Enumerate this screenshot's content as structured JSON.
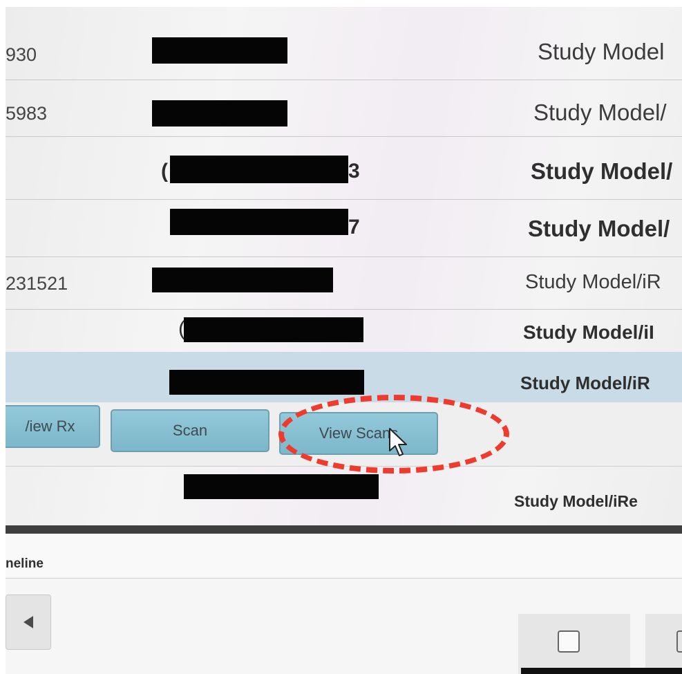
{
  "rows": [
    {
      "case_id": "930",
      "type": "Study Model",
      "bold": false
    },
    {
      "case_id": "5983",
      "type": "Study Model/",
      "bold": false
    },
    {
      "case_id": "",
      "peek_left": "(",
      "peek_right": "3",
      "type": "Study Model/",
      "bold": true
    },
    {
      "case_id": "",
      "peek_right": "7",
      "type": "Study Model/",
      "bold": true
    },
    {
      "case_id": "231521",
      "type": "Study Model/iR",
      "bold": false
    },
    {
      "case_id": "",
      "peek_left": "(",
      "type": "Study Model/iI",
      "bold": true
    },
    {
      "case_id": "",
      "type": "Study Model/iR",
      "bold": true,
      "selected": true
    },
    {
      "case_id": "",
      "type": "Study Model/iRe",
      "bold": true
    }
  ],
  "actions": {
    "view_rx": "/iew Rx",
    "scan": "Scan",
    "view_scans": "View Scans"
  },
  "timeline": {
    "label": "neline"
  },
  "colors": {
    "button_fill": "#88c0d3",
    "selected_row": "#c9dbe7",
    "annotation": "#ef3a2e"
  },
  "icons": {
    "prev": "triangle-left-icon",
    "cursor": "mouse-pointer-icon"
  }
}
